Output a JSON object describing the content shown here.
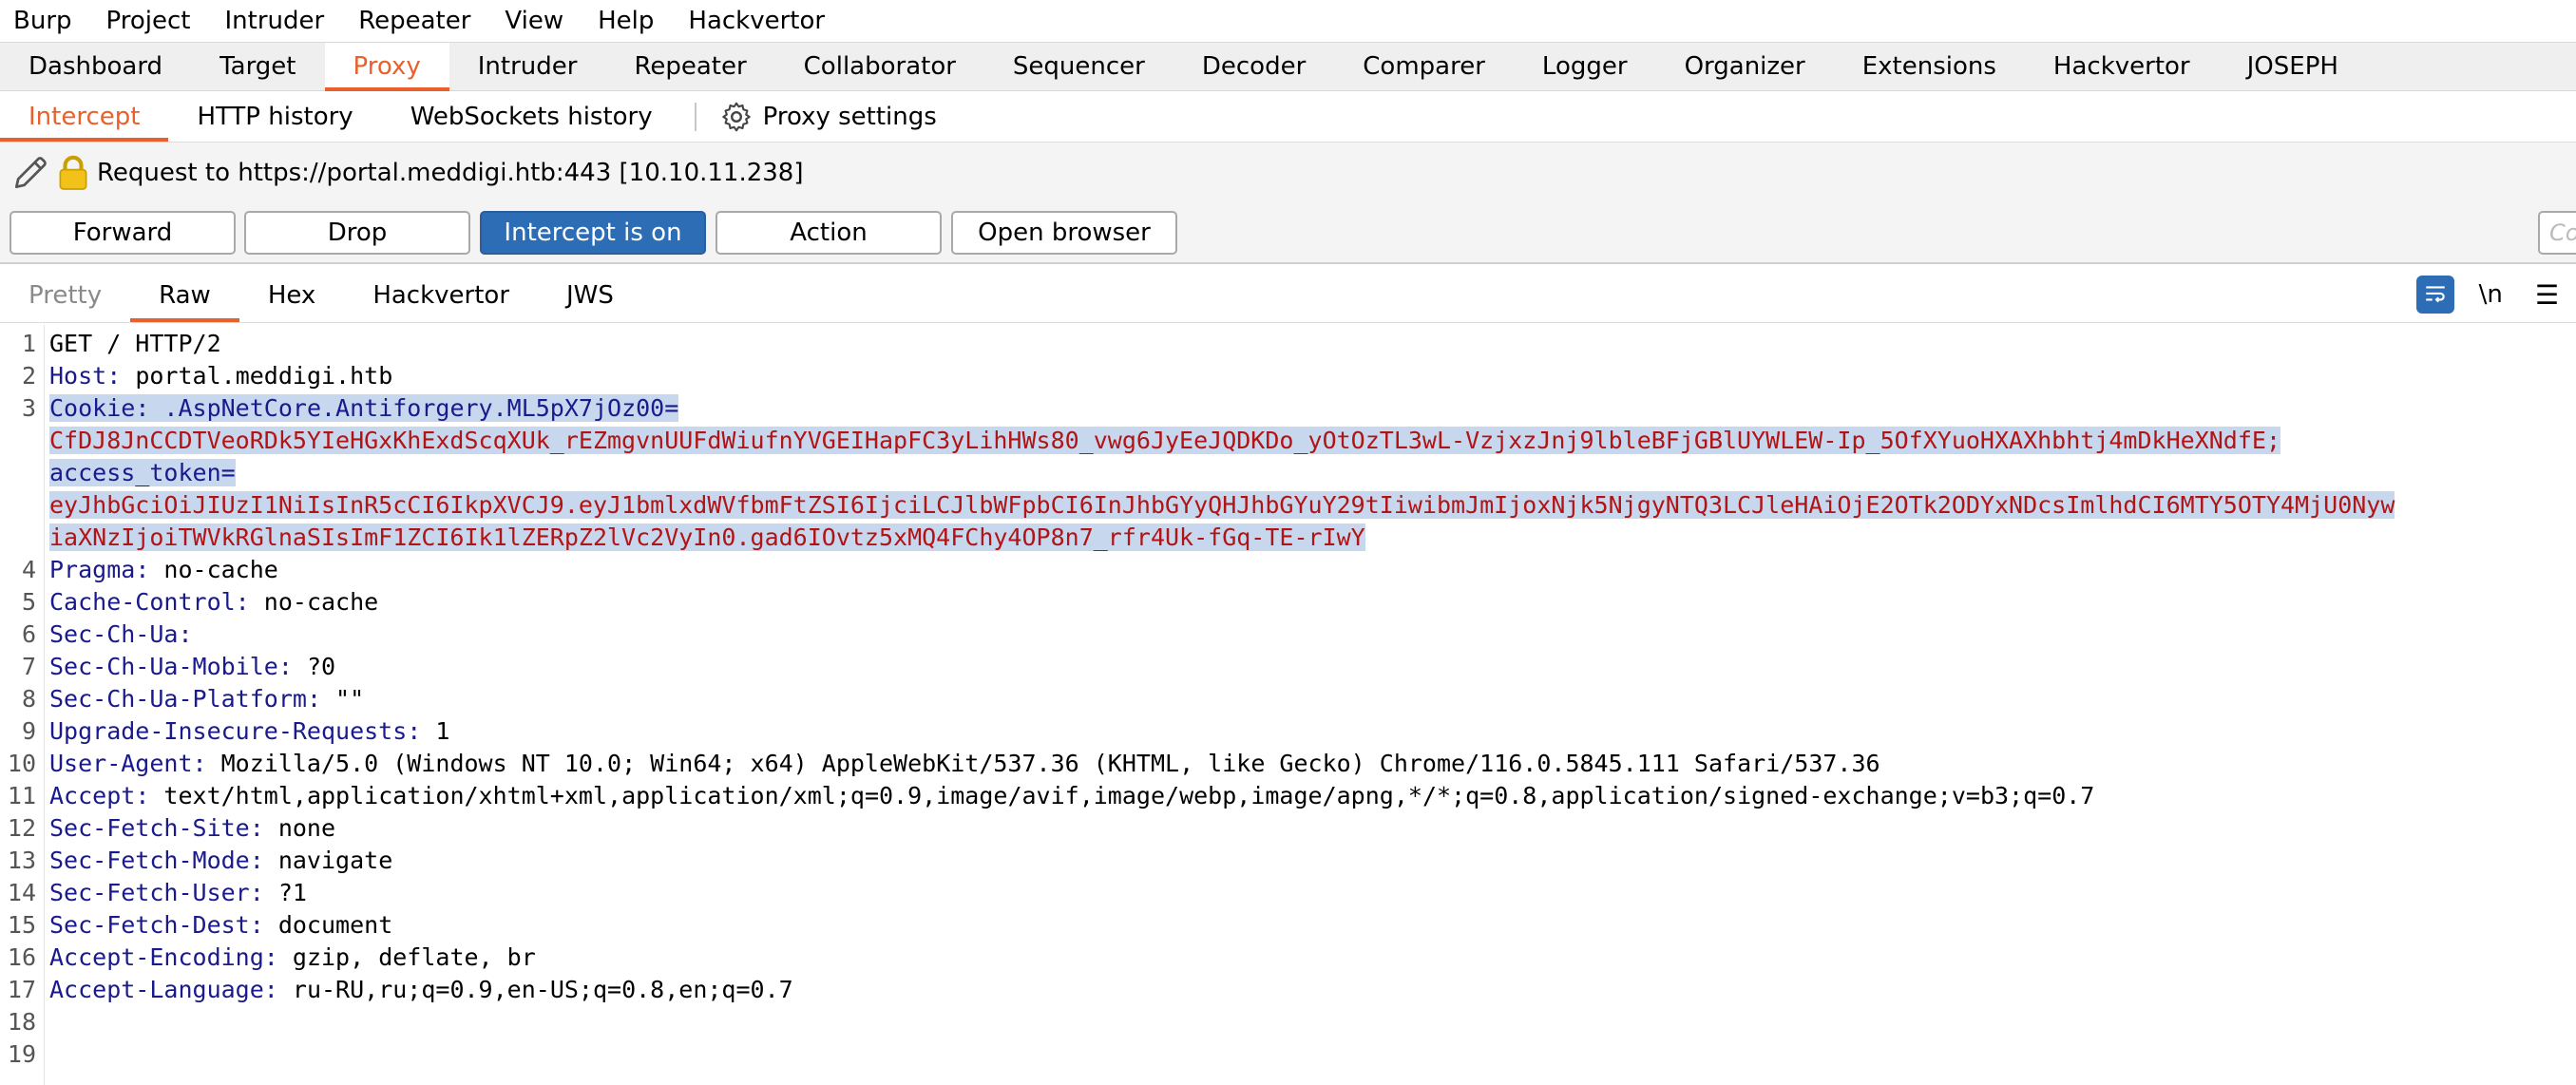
{
  "menubar": [
    "Burp",
    "Project",
    "Intruder",
    "Repeater",
    "View",
    "Help",
    "Hackvertor"
  ],
  "main_tabs": [
    "Dashboard",
    "Target",
    "Proxy",
    "Intruder",
    "Repeater",
    "Collaborator",
    "Sequencer",
    "Decoder",
    "Comparer",
    "Logger",
    "Organizer",
    "Extensions",
    "Hackvertor",
    "JOSEPH"
  ],
  "main_tab_active": "Proxy",
  "sub_tabs": [
    "Intercept",
    "HTTP history",
    "WebSockets history"
  ],
  "proxy_settings_label": "Proxy settings",
  "request": {
    "label": "Request to https://portal.meddigi.htb:443  [10.10.11.238]"
  },
  "buttons": {
    "forward": "Forward",
    "drop": "Drop",
    "intercept": "Intercept is on",
    "action": "Action",
    "open_browser": "Open browser"
  },
  "comment_placeholder": "Co",
  "editor_tabs": [
    "Pretty",
    "Raw",
    "Hex",
    "Hackvertor",
    "JWS"
  ],
  "editor_tab_active": "Raw",
  "newline_toggle": "\\n",
  "colors": {
    "accent": "#e8612c",
    "primary": "#2d6db5",
    "header_key": "#1a1a8c",
    "cookie_value": "#b11414",
    "selection": "#c7d7ee"
  },
  "code": {
    "l1": "GET / HTTP/2",
    "l2_key": "Host",
    "l2_val": " portal.meddigi.htb",
    "l3_key": "Cookie",
    "l3_name": " .AspNetCore.Antiforgery.ML5pX7jOz00=",
    "l3_value": "CfDJ8JnCCDTVeoRDk5YIeHGxKhExdScqXUk_rEZmgvnUUFdWiufnYVGEIHapFC3yLihHWs80_vwg6JyEeJQDKDo_yOtOzTL3wL-VzjxzJnj9lbleBFjGBlUYWLEW-Ip_5OfXYuoHXAXhbhtj4mDkHeXNdfE;",
    "l3_token_name": "access_token=",
    "l3_token_1": "eyJhbGciOiJIUzI1NiIsInR5cCI6IkpXVCJ9.eyJ1bmlxdWVfbmFtZSI6IjciLCJlbWFpbCI6InJhbGYyQHJhbGYuY29tIiwibmJmIjoxNjk5NjgyNTQ3LCJleHAiOjE2OTk2ODYxNDcsImlhdCI6MTY5OTY4MjU0Nyw",
    "l3_token_2": "iaXNzIjoiTWVkRGlnaSIsImF1ZCI6Ik1lZERpZ2lVc2VyIn0.gad6IOvtz5xMQ4FChy4OP8n7_rfr4Uk-fGq-TE-rIwY",
    "l4_key": "Pragma",
    "l4_val": " no-cache",
    "l5_key": "Cache-Control",
    "l5_val": " no-cache",
    "l6_key": "Sec-Ch-Ua",
    "l6_val": "",
    "l7_key": "Sec-Ch-Ua-Mobile",
    "l7_val": " ?0",
    "l8_key": "Sec-Ch-Ua-Platform",
    "l8_val": " \"\"",
    "l9_key": "Upgrade-Insecure-Requests",
    "l9_val": " 1",
    "l10_key": "User-Agent",
    "l10_val": " Mozilla/5.0 (Windows NT 10.0; Win64; x64) AppleWebKit/537.36 (KHTML, like Gecko) Chrome/116.0.5845.111 Safari/537.36",
    "l11_key": "Accept",
    "l11_val": " text/html,application/xhtml+xml,application/xml;q=0.9,image/avif,image/webp,image/apng,*/*;q=0.8,application/signed-exchange;v=b3;q=0.7",
    "l12_key": "Sec-Fetch-Site",
    "l12_val": " none",
    "l13_key": "Sec-Fetch-Mode",
    "l13_val": " navigate",
    "l14_key": "Sec-Fetch-User",
    "l14_val": " ?1",
    "l15_key": "Sec-Fetch-Dest",
    "l15_val": " document",
    "l16_key": "Accept-Encoding",
    "l16_val": " gzip, deflate, br",
    "l17_key": "Accept-Language",
    "l17_val": " ru-RU,ru;q=0.9,en-US;q=0.8,en;q=0.7"
  },
  "line_numbers": [
    "1",
    "2",
    "3",
    "4",
    "5",
    "6",
    "7",
    "8",
    "9",
    "10",
    "11",
    "12",
    "13",
    "14",
    "15",
    "16",
    "17",
    "18",
    "19"
  ]
}
